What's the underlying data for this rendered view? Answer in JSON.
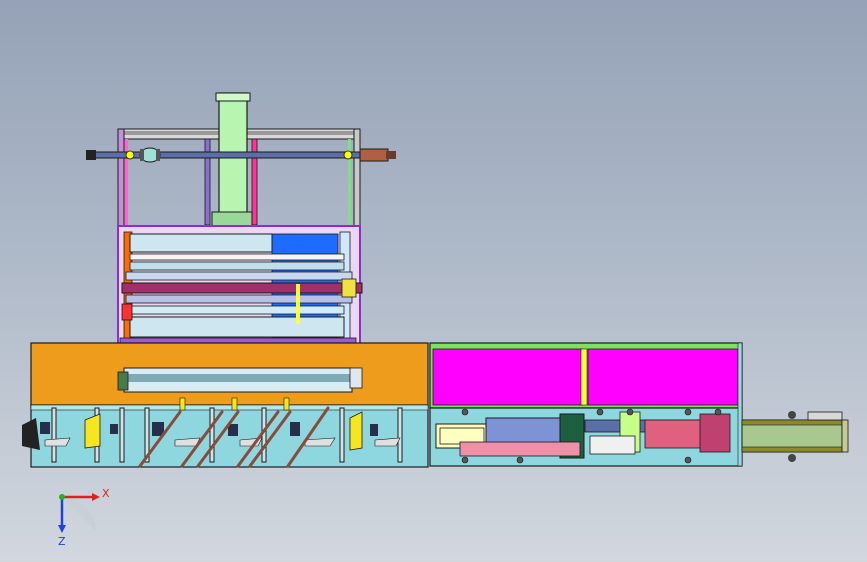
{
  "viewport": {
    "background_top": "#95a2b7",
    "background_bottom": "#d2d7de"
  },
  "model": {
    "colors": {
      "outline": "#1a1a1a",
      "frame_purple": "#8a2be2",
      "frame_magenta": "#ff00ff",
      "frame_pink": "#ff66cc",
      "beam_gray": "#c9c9c9",
      "column_green": "#b8f5b0",
      "orange_body": "#ee9c1c",
      "pink_panel": "#ff00ff",
      "yellow_strip": "#ffff33",
      "cyan_box": "#aee6ee",
      "blue_panel": "#1e6cff",
      "roller_light": "#cde6f0",
      "base_cyan": "#8fd7df",
      "rod_brown": "#8b4a3a",
      "conveyor_olive": "#8a8a2a",
      "conveyor_green": "#a8c890",
      "motor_blue": "#7d93d6",
      "shaft_steel": "#5a6ea8"
    }
  },
  "triad": {
    "x_label": "X",
    "z_label": "Z",
    "x_color": "#e02020",
    "z_color": "#2040e0",
    "y_color": "#20b020"
  }
}
